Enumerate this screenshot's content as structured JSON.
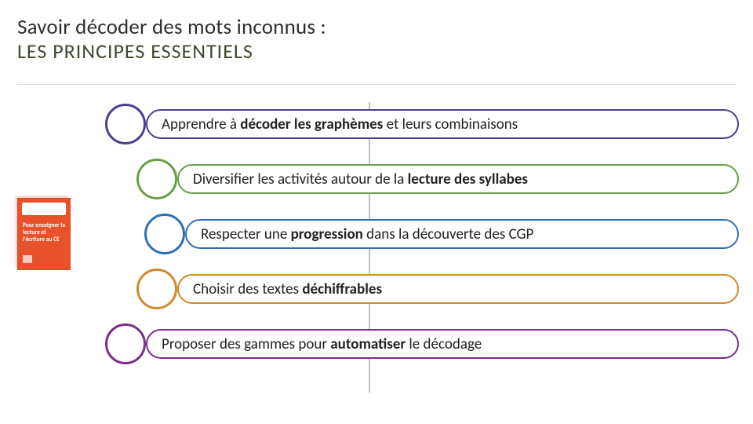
{
  "title": "Savoir décoder des mots inconnus :",
  "subtitle": "LES PRINCIPES ESSENTIELS",
  "rows": [
    {
      "pre": "Apprendre à ",
      "bold": "décoder les graphèmes",
      "post": " et leurs combinaisons"
    },
    {
      "pre": "Diversifier les activités autour de la ",
      "bold": "lecture des syllabes",
      "post": ""
    },
    {
      "pre": "Respecter une ",
      "bold": "progression",
      "post": " dans la découverte des CGP"
    },
    {
      "pre": "Choisir des textes ",
      "bold": "déchiffrables",
      "post": ""
    },
    {
      "pre": "Proposer des gammes pour ",
      "bold": "automatiser",
      "post": " le décodage"
    }
  ],
  "book": {
    "line": "Pour enseigner la lecture et l'écriture au CE"
  }
}
